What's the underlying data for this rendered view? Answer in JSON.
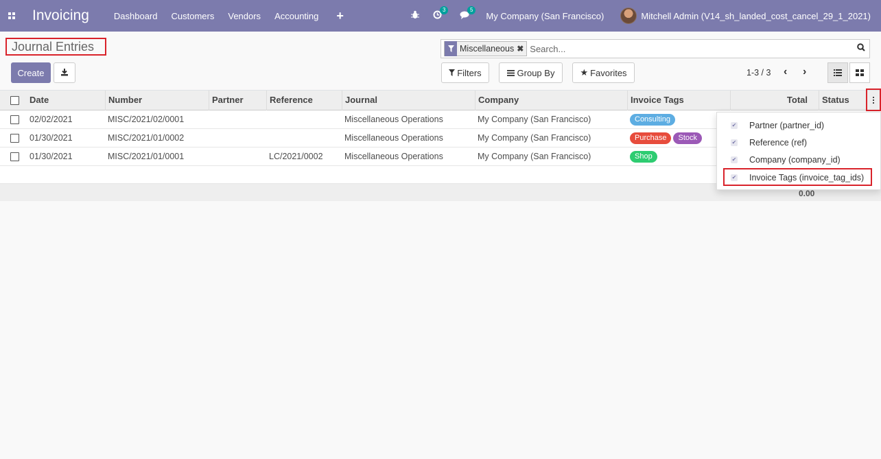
{
  "navbar": {
    "brand": "Invoicing",
    "menu": [
      "Dashboard",
      "Customers",
      "Vendors",
      "Accounting"
    ],
    "activity_count": "3",
    "message_count": "5",
    "company": "My Company (San Francisco)",
    "user": "Mitchell Admin (V14_sh_landed_cost_cancel_29_1_2021)"
  },
  "page": {
    "title": "Journal Entries",
    "create_label": "Create"
  },
  "search": {
    "facet": "Miscellaneous",
    "placeholder": "Search..."
  },
  "filters": {
    "filters_label": "Filters",
    "group_by_label": "Group By",
    "favorites_label": "Favorites"
  },
  "pager": {
    "value": "1-3 / 3"
  },
  "table": {
    "columns": [
      "Date",
      "Number",
      "Partner",
      "Reference",
      "Journal",
      "Company",
      "Invoice Tags",
      "Total",
      "Status"
    ],
    "rows": [
      {
        "date": "02/02/2021",
        "number": "MISC/2021/02/0001",
        "partner": "",
        "reference": "",
        "journal": "Miscellaneous Operations",
        "company": "My Company (San Francisco)",
        "tags": [
          {
            "label": "Consulting",
            "color": "#5dade2"
          }
        ]
      },
      {
        "date": "01/30/2021",
        "number": "MISC/2021/01/0002",
        "partner": "",
        "reference": "",
        "journal": "Miscellaneous Operations",
        "company": "My Company (San Francisco)",
        "tags": [
          {
            "label": "Purchase",
            "color": "#e74c3c"
          },
          {
            "label": "Stock",
            "color": "#9b59b6"
          }
        ]
      },
      {
        "date": "01/30/2021",
        "number": "MISC/2021/01/0001",
        "partner": "",
        "reference": "LC/2021/0002",
        "journal": "Miscellaneous Operations",
        "company": "My Company (San Francisco)",
        "tags": [
          {
            "label": "Shop",
            "color": "#2ecc71"
          }
        ]
      }
    ],
    "footer_total": "0.00"
  },
  "optional_columns": [
    "Partner (partner_id)",
    "Reference (ref)",
    "Company (company_id)",
    "Invoice Tags (invoice_tag_ids)"
  ],
  "colors": {
    "brand": "#7c7bad",
    "highlight": "#d9222a"
  }
}
